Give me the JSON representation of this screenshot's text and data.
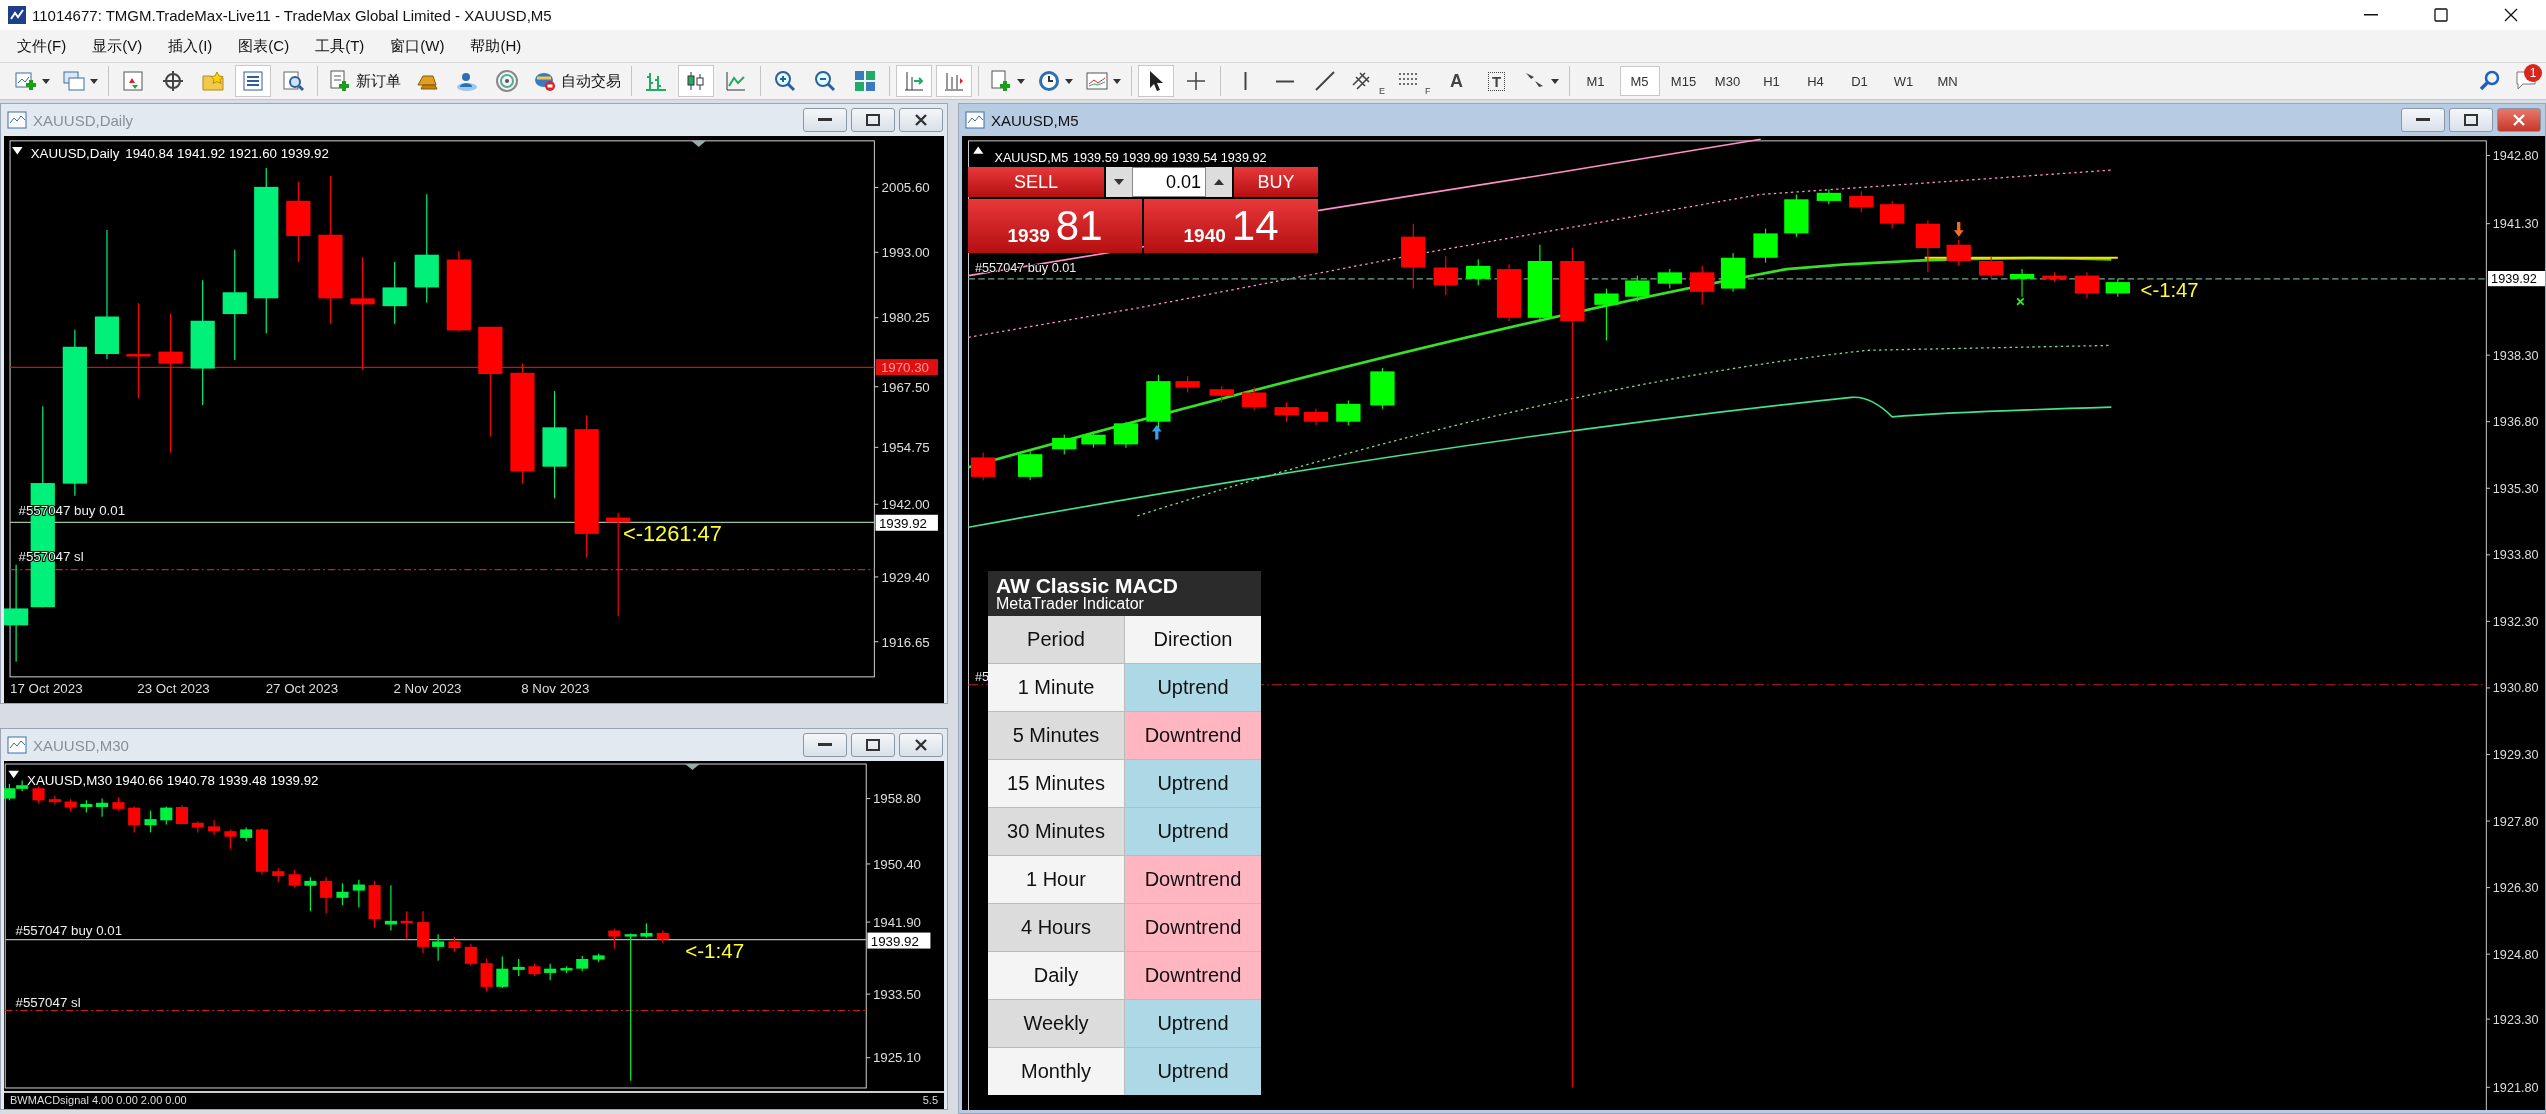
{
  "window": {
    "title": "11014677: TMGM.TradeMax-Live11 - TradeMax Global Limited - XAUUSD,M5"
  },
  "menu": [
    "文件(F)",
    "显示(V)",
    "插入(I)",
    "图表(C)",
    "工具(T)",
    "窗口(W)",
    "帮助(H)"
  ],
  "toolbar": {
    "groups": [
      [
        {
          "kind": "new-chart",
          "dropdown": true,
          "selected": false
        },
        {
          "kind": "profiles",
          "dropdown": true,
          "selected": false
        }
      ],
      [
        {
          "kind": "market-watch",
          "selected": false
        },
        {
          "kind": "data-window",
          "selected": false
        },
        {
          "kind": "navigator",
          "selected": false
        },
        {
          "kind": "terminal",
          "selected": true
        },
        {
          "kind": "tester",
          "selected": false
        }
      ],
      [
        {
          "kind": "new-order",
          "label": "新订单",
          "selected": false
        },
        {
          "kind": "metaeditor",
          "selected": false
        },
        {
          "kind": "community",
          "selected": false
        },
        {
          "kind": "signals",
          "selected": false
        },
        {
          "kind": "autotrading",
          "label": "自动交易",
          "selected": false
        }
      ],
      [
        {
          "kind": "bar-chart",
          "selected": false
        },
        {
          "kind": "candles",
          "selected": true
        },
        {
          "kind": "line-chart",
          "selected": false
        }
      ],
      [
        {
          "kind": "zoom-in",
          "selected": false
        },
        {
          "kind": "zoom-out",
          "selected": false
        },
        {
          "kind": "tile",
          "selected": false
        }
      ],
      [
        {
          "kind": "autoscroll",
          "selected": true
        },
        {
          "kind": "chart-shift",
          "selected": true
        }
      ],
      [
        {
          "kind": "indicators",
          "dropdown": true,
          "selected": false
        },
        {
          "kind": "periods",
          "dropdown": true,
          "selected": false
        },
        {
          "kind": "templates",
          "dropdown": true,
          "selected": false
        }
      ],
      [
        {
          "kind": "cursor",
          "selected": true
        },
        {
          "kind": "crosshair",
          "selected": false
        }
      ],
      [
        {
          "kind": "vline",
          "selected": false
        },
        {
          "kind": "hline",
          "selected": false
        },
        {
          "kind": "trendline",
          "selected": false
        },
        {
          "kind": "channel",
          "letter": "E",
          "selected": false
        },
        {
          "kind": "fibo",
          "letter": "F",
          "selected": false
        },
        {
          "kind": "text",
          "glyph": "A",
          "selected": false
        },
        {
          "kind": "label",
          "glyph": "T",
          "selected": false
        },
        {
          "kind": "arrows",
          "dropdown": true,
          "selected": false
        }
      ]
    ],
    "timeframes": [
      {
        "label": "M1",
        "selected": false
      },
      {
        "label": "M5",
        "selected": true
      },
      {
        "label": "M15",
        "selected": false
      },
      {
        "label": "M30",
        "selected": false
      },
      {
        "label": "H1",
        "selected": false
      },
      {
        "label": "H4",
        "selected": false
      },
      {
        "label": "D1",
        "selected": false
      },
      {
        "label": "W1",
        "selected": false
      },
      {
        "label": "MN",
        "selected": false
      }
    ],
    "notifications": "1"
  },
  "charts": [
    {
      "title": "XAUUSD,Daily",
      "active": false,
      "header": {
        "symbol": "XAUUSD,Daily",
        "ohlc": "1940.84 1941.92 1921.60 1939.92"
      },
      "price_axis": [
        "2005.60",
        "1993.00",
        "1980.25",
        "1967.50",
        "1954.75",
        "1942.00",
        "1929.40",
        "1916.65"
      ],
      "alert_price": "1970.30",
      "current_price": "1939.92",
      "orders": [
        {
          "label": "#557047 buy 0.01",
          "kind": "entry"
        },
        {
          "label": "#557047 sl",
          "kind": "stop"
        }
      ],
      "countdown": "<-1261:47",
      "time_axis": [
        "17 Oct 2023",
        "23 Oct 2023",
        "27 Oct 2023",
        "2 Nov 2023",
        "8 Nov 2023"
      ]
    },
    {
      "title": "XAUUSD,M30",
      "active": false,
      "header": {
        "symbol": "XAUUSD,M30",
        "ohlc": "1940.66 1940.78 1939.48 1939.92"
      },
      "price_axis": [
        "1958.80",
        "1950.40",
        "1941.90",
        "1933.50",
        "1925.10"
      ],
      "current_price": "1939.92",
      "orders": [
        {
          "label": "#557047 buy 0.01",
          "kind": "entry"
        },
        {
          "label": "#557047 sl",
          "kind": "stop"
        }
      ],
      "countdown": "<-1:47",
      "subwindow": {
        "title": "BWMACDsignal 4.00 0.00 2.00 0.00",
        "axis": "5.5"
      }
    },
    {
      "title": "XAUUSD,M5",
      "active": true,
      "header": {
        "symbol": "XAUUSD,M5",
        "ohlc": "1939.59 1939.99 1939.54 1939.92"
      },
      "price_axis": [
        "1942.80",
        "1941.30",
        "1938.30",
        "1936.80",
        "1935.30",
        "1933.80",
        "1932.30",
        "1930.80",
        "1929.30",
        "1927.80",
        "1926.30",
        "1924.80",
        "1923.30",
        "1921.80"
      ],
      "current_price": "1939.92",
      "orders": [
        {
          "label": "#557047 buy 0.01",
          "kind": "entry"
        },
        {
          "label": "#5",
          "kind": "stop"
        }
      ],
      "countdown": "<-1:47",
      "trade_panel": {
        "sell": "SELL",
        "buy": "BUY",
        "lot": "0.01",
        "bid_figure": "1939",
        "bid_pips": "81",
        "ask_figure": "1940",
        "ask_pips": "14"
      },
      "indicator_table": {
        "title": "AW Classic MACD",
        "subtitle": "MetaTrader Indicator",
        "columns": [
          "Period",
          "Direction"
        ],
        "rows": [
          {
            "period": "1 Minute",
            "direction": "Uptrend",
            "kind": "up"
          },
          {
            "period": "5 Minutes",
            "direction": "Downtrend",
            "kind": "down"
          },
          {
            "period": "15 Minutes",
            "direction": "Uptrend",
            "kind": "up"
          },
          {
            "period": "30 Minutes",
            "direction": "Uptrend",
            "kind": "up"
          },
          {
            "period": "1 Hour",
            "direction": "Downtrend",
            "kind": "down"
          },
          {
            "period": "4 Hours",
            "direction": "Downtrend",
            "kind": "down"
          },
          {
            "period": "Daily",
            "direction": "Downtrend",
            "kind": "down"
          },
          {
            "period": "Weekly",
            "direction": "Uptrend",
            "kind": "up"
          },
          {
            "period": "Monthly",
            "direction": "Uptrend",
            "kind": "up"
          }
        ]
      }
    }
  ]
}
